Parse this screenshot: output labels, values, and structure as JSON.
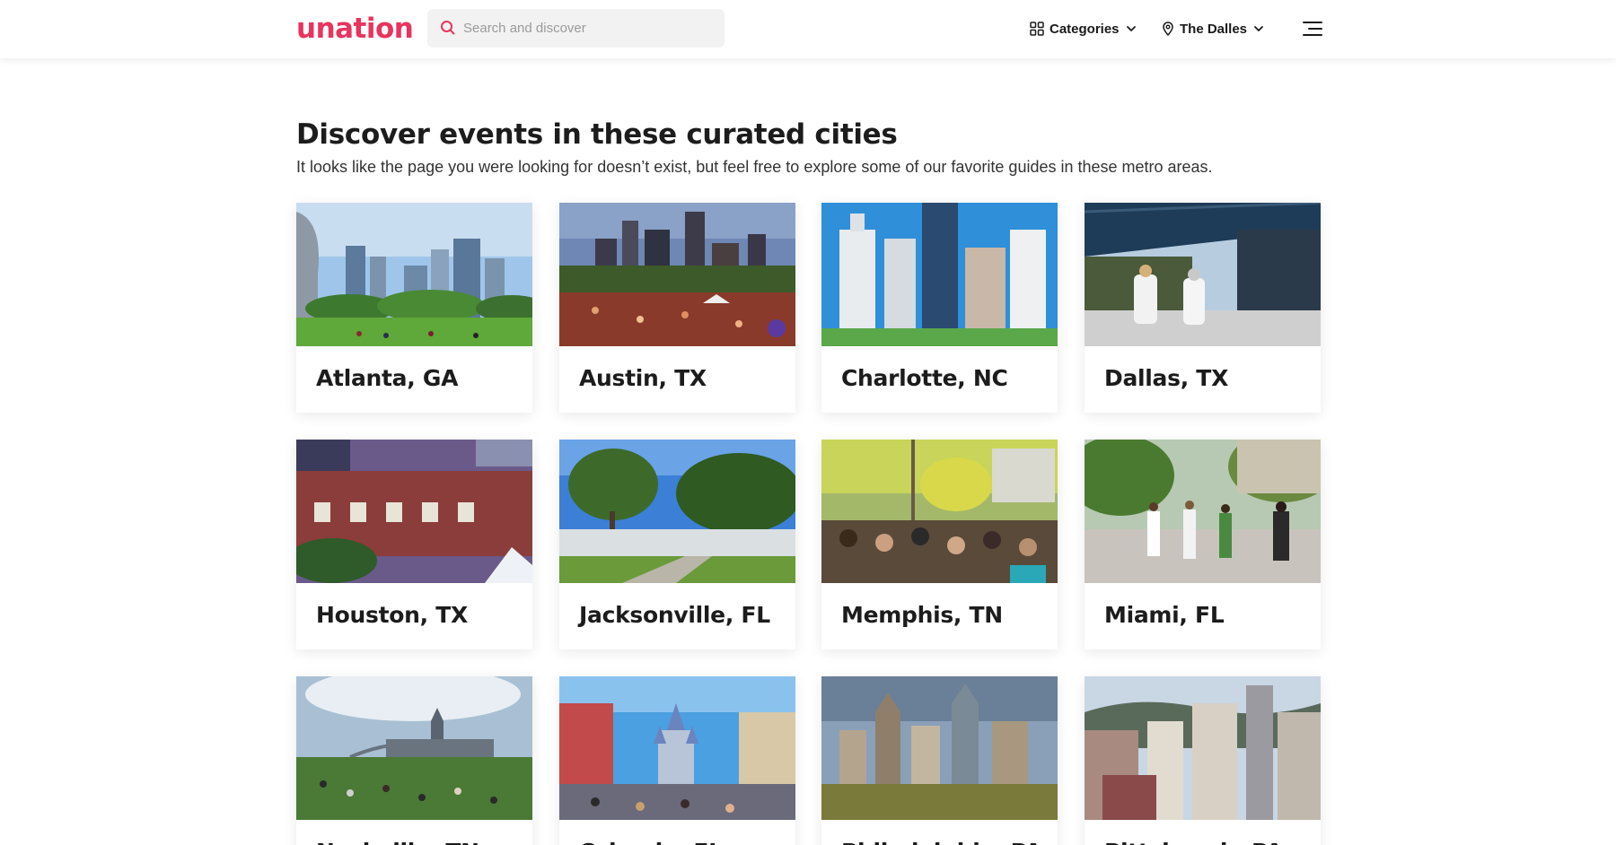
{
  "header": {
    "logo": "unation",
    "search": {
      "placeholder": "Search and discover",
      "value": ""
    },
    "categories_label": "Categories",
    "location_label": "The Dalles"
  },
  "main": {
    "title": "Discover events in these curated cities",
    "subtitle": "It looks like the page you were looking for doesn’t exist, but feel free to explore some of our favorite guides in these metro areas.",
    "cities": [
      {
        "name": "Atlanta, GA",
        "scene": "park-skyline"
      },
      {
        "name": "Austin, TX",
        "scene": "night-crowd"
      },
      {
        "name": "Charlotte, NC",
        "scene": "white-towers"
      },
      {
        "name": "Dallas, TX",
        "scene": "pavilion-walk"
      },
      {
        "name": "Houston, TX",
        "scene": "brick-building"
      },
      {
        "name": "Jacksonville, FL",
        "scene": "oak-park"
      },
      {
        "name": "Memphis, TN",
        "scene": "seated-crowd"
      },
      {
        "name": "Miami, FL",
        "scene": "plaza-walk"
      },
      {
        "name": "Nashville, TN",
        "scene": "lawn-concert"
      },
      {
        "name": "Orlando, FL",
        "scene": "castle-street"
      },
      {
        "name": "Philadelphia, PA",
        "scene": "downtown-skyline"
      },
      {
        "name": "Pittsburgh, PA",
        "scene": "hill-city"
      }
    ]
  },
  "colors": {
    "brand": "#e8345e",
    "text": "#1c1c1c",
    "search_bg": "#f2f2f2"
  },
  "icons": [
    "search-icon",
    "grid-icon",
    "chevron-down-icon",
    "map-pin-icon",
    "menu-icon"
  ]
}
